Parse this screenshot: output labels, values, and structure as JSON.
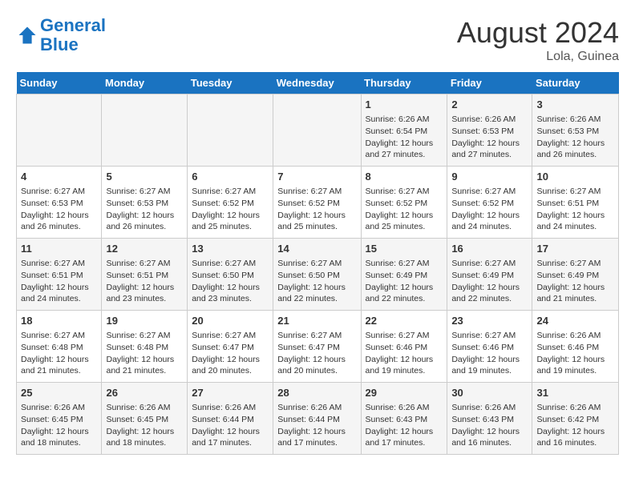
{
  "header": {
    "logo_line1": "General",
    "logo_line2": "Blue",
    "month": "August 2024",
    "location": "Lola, Guinea"
  },
  "days_of_week": [
    "Sunday",
    "Monday",
    "Tuesday",
    "Wednesday",
    "Thursday",
    "Friday",
    "Saturday"
  ],
  "weeks": [
    [
      {
        "day": "",
        "info": ""
      },
      {
        "day": "",
        "info": ""
      },
      {
        "day": "",
        "info": ""
      },
      {
        "day": "",
        "info": ""
      },
      {
        "day": "1",
        "info": "Sunrise: 6:26 AM\nSunset: 6:54 PM\nDaylight: 12 hours and 27 minutes."
      },
      {
        "day": "2",
        "info": "Sunrise: 6:26 AM\nSunset: 6:53 PM\nDaylight: 12 hours and 27 minutes."
      },
      {
        "day": "3",
        "info": "Sunrise: 6:26 AM\nSunset: 6:53 PM\nDaylight: 12 hours and 26 minutes."
      }
    ],
    [
      {
        "day": "4",
        "info": "Sunrise: 6:27 AM\nSunset: 6:53 PM\nDaylight: 12 hours and 26 minutes."
      },
      {
        "day": "5",
        "info": "Sunrise: 6:27 AM\nSunset: 6:53 PM\nDaylight: 12 hours and 26 minutes."
      },
      {
        "day": "6",
        "info": "Sunrise: 6:27 AM\nSunset: 6:52 PM\nDaylight: 12 hours and 25 minutes."
      },
      {
        "day": "7",
        "info": "Sunrise: 6:27 AM\nSunset: 6:52 PM\nDaylight: 12 hours and 25 minutes."
      },
      {
        "day": "8",
        "info": "Sunrise: 6:27 AM\nSunset: 6:52 PM\nDaylight: 12 hours and 25 minutes."
      },
      {
        "day": "9",
        "info": "Sunrise: 6:27 AM\nSunset: 6:52 PM\nDaylight: 12 hours and 24 minutes."
      },
      {
        "day": "10",
        "info": "Sunrise: 6:27 AM\nSunset: 6:51 PM\nDaylight: 12 hours and 24 minutes."
      }
    ],
    [
      {
        "day": "11",
        "info": "Sunrise: 6:27 AM\nSunset: 6:51 PM\nDaylight: 12 hours and 24 minutes."
      },
      {
        "day": "12",
        "info": "Sunrise: 6:27 AM\nSunset: 6:51 PM\nDaylight: 12 hours and 23 minutes."
      },
      {
        "day": "13",
        "info": "Sunrise: 6:27 AM\nSunset: 6:50 PM\nDaylight: 12 hours and 23 minutes."
      },
      {
        "day": "14",
        "info": "Sunrise: 6:27 AM\nSunset: 6:50 PM\nDaylight: 12 hours and 22 minutes."
      },
      {
        "day": "15",
        "info": "Sunrise: 6:27 AM\nSunset: 6:49 PM\nDaylight: 12 hours and 22 minutes."
      },
      {
        "day": "16",
        "info": "Sunrise: 6:27 AM\nSunset: 6:49 PM\nDaylight: 12 hours and 22 minutes."
      },
      {
        "day": "17",
        "info": "Sunrise: 6:27 AM\nSunset: 6:49 PM\nDaylight: 12 hours and 21 minutes."
      }
    ],
    [
      {
        "day": "18",
        "info": "Sunrise: 6:27 AM\nSunset: 6:48 PM\nDaylight: 12 hours and 21 minutes."
      },
      {
        "day": "19",
        "info": "Sunrise: 6:27 AM\nSunset: 6:48 PM\nDaylight: 12 hours and 21 minutes."
      },
      {
        "day": "20",
        "info": "Sunrise: 6:27 AM\nSunset: 6:47 PM\nDaylight: 12 hours and 20 minutes."
      },
      {
        "day": "21",
        "info": "Sunrise: 6:27 AM\nSunset: 6:47 PM\nDaylight: 12 hours and 20 minutes."
      },
      {
        "day": "22",
        "info": "Sunrise: 6:27 AM\nSunset: 6:46 PM\nDaylight: 12 hours and 19 minutes."
      },
      {
        "day": "23",
        "info": "Sunrise: 6:27 AM\nSunset: 6:46 PM\nDaylight: 12 hours and 19 minutes."
      },
      {
        "day": "24",
        "info": "Sunrise: 6:26 AM\nSunset: 6:46 PM\nDaylight: 12 hours and 19 minutes."
      }
    ],
    [
      {
        "day": "25",
        "info": "Sunrise: 6:26 AM\nSunset: 6:45 PM\nDaylight: 12 hours and 18 minutes."
      },
      {
        "day": "26",
        "info": "Sunrise: 6:26 AM\nSunset: 6:45 PM\nDaylight: 12 hours and 18 minutes."
      },
      {
        "day": "27",
        "info": "Sunrise: 6:26 AM\nSunset: 6:44 PM\nDaylight: 12 hours and 17 minutes."
      },
      {
        "day": "28",
        "info": "Sunrise: 6:26 AM\nSunset: 6:44 PM\nDaylight: 12 hours and 17 minutes."
      },
      {
        "day": "29",
        "info": "Sunrise: 6:26 AM\nSunset: 6:43 PM\nDaylight: 12 hours and 17 minutes."
      },
      {
        "day": "30",
        "info": "Sunrise: 6:26 AM\nSunset: 6:43 PM\nDaylight: 12 hours and 16 minutes."
      },
      {
        "day": "31",
        "info": "Sunrise: 6:26 AM\nSunset: 6:42 PM\nDaylight: 12 hours and 16 minutes."
      }
    ]
  ]
}
